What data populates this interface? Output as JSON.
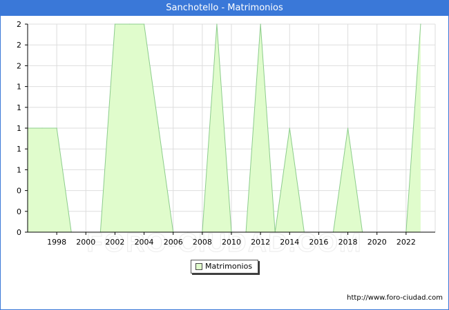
{
  "window": {
    "title": "Sanchotello - Matrimonios"
  },
  "watermark": "FORO-CIUDAD.COM",
  "source_url": "http://www.foro-ciudad.com",
  "colors": {
    "header": "#3a78d8",
    "fill": "#e0fccc",
    "line": "#8ccc8c",
    "grid": "#dddddd",
    "axis": "#000000"
  },
  "chart_data": {
    "type": "area",
    "x": [
      1996,
      1997,
      1998,
      1999,
      2000,
      2001,
      2002,
      2003,
      2004,
      2005,
      2006,
      2007,
      2008,
      2009,
      2010,
      2011,
      2012,
      2013,
      2014,
      2015,
      2016,
      2017,
      2018,
      2019,
      2020,
      2021,
      2022,
      2023
    ],
    "series": [
      {
        "name": "Matrimonios",
        "values": [
          1,
          1,
          1,
          0,
          0,
          0,
          2,
          2,
          2,
          1,
          0,
          0,
          0,
          2,
          0,
          0,
          2,
          0,
          1,
          0,
          0,
          0,
          1,
          0,
          0,
          0,
          0,
          2
        ]
      }
    ],
    "x_ticks": [
      "1998",
      "2000",
      "2002",
      "2004",
      "2006",
      "2008",
      "2010",
      "2012",
      "2014",
      "2016",
      "2018",
      "2020",
      "2022"
    ],
    "x_tick_values": [
      1998,
      2000,
      2002,
      2004,
      2006,
      2008,
      2010,
      2012,
      2014,
      2016,
      2018,
      2020,
      2022
    ],
    "y_ticks": [
      "0",
      "0",
      "0",
      "1",
      "1",
      "1",
      "1",
      "1",
      "2",
      "2",
      "2"
    ],
    "y_tick_values": [
      0,
      0.2,
      0.4,
      0.6,
      0.8,
      1.0,
      1.2,
      1.4,
      1.6,
      1.8,
      2.0
    ],
    "xlim": [
      1996,
      2024
    ],
    "ylim": [
      0,
      2
    ],
    "grid": true,
    "legend_position": "bottom-center",
    "title": "Sanchotello - Matrimonios",
    "xlabel": "",
    "ylabel": ""
  }
}
